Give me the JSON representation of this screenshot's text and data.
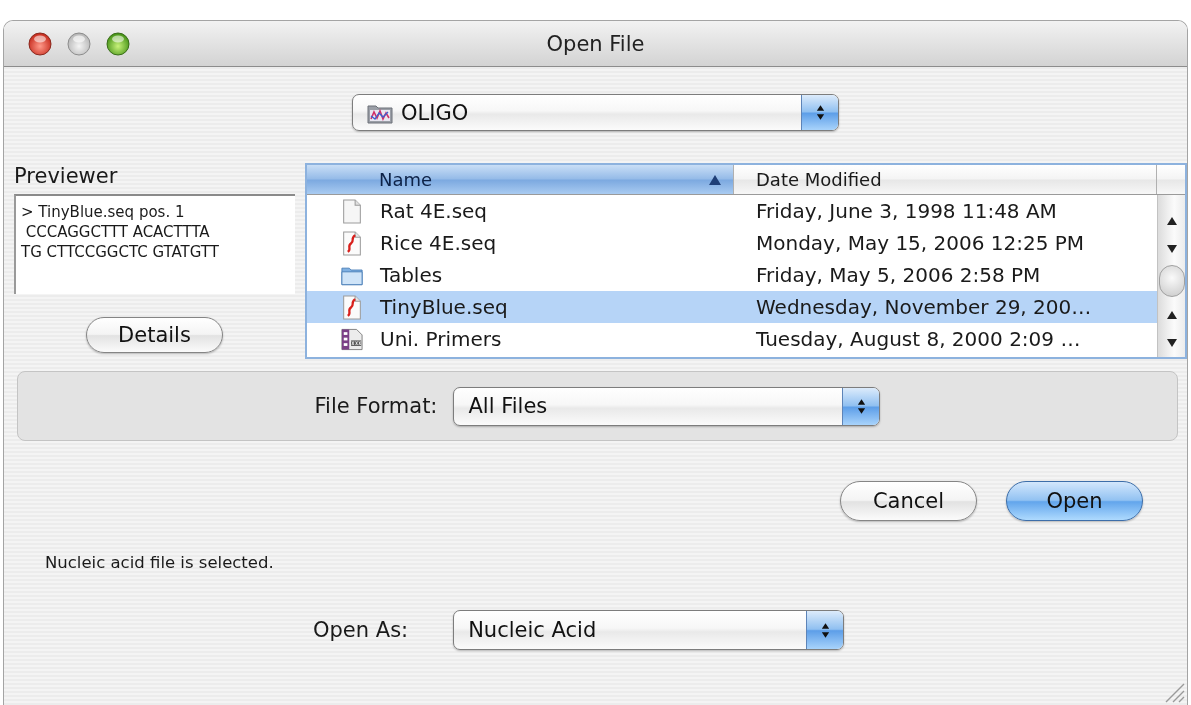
{
  "window": {
    "title": "Open File"
  },
  "location": {
    "value": "OLIGO"
  },
  "previewer": {
    "label": "Previewer",
    "lines": [
      "> TinyBlue.seq pos. 1",
      " CCCAGGCTTT ACACTTTA",
      "TG CTTCCGGCTC GTATGTT"
    ],
    "button": "Details"
  },
  "file_list": {
    "columns": [
      {
        "label": "Name",
        "sorted": true
      },
      {
        "label": "Date Modified",
        "sorted": false
      }
    ],
    "rows": [
      {
        "kind": "document",
        "name": "Rat 4E.seq",
        "date_modified": "Friday, June 3, 1998 11:48 AM",
        "selected": false
      },
      {
        "kind": "sequence",
        "name": "Rice 4E.seq",
        "date_modified": "Monday, May 15, 2006 12:25 PM",
        "selected": false
      },
      {
        "kind": "folder",
        "name": "Tables",
        "date_modified": "Friday, May 5, 2006 2:58 PM",
        "selected": false
      },
      {
        "kind": "sequence",
        "name": "TinyBlue.seq",
        "date_modified": "Wednesday, November 29, 200…",
        "selected": true
      },
      {
        "kind": "primers",
        "name": "Uni. Primers",
        "date_modified": "Tuesday, August 8, 2000 2:09 …",
        "selected": false
      }
    ]
  },
  "file_format": {
    "label": "File Format:",
    "value": "All Files"
  },
  "buttons": [
    {
      "label": "Cancel",
      "default": false
    },
    {
      "label": "Open",
      "default": true
    }
  ],
  "status": "Nucleic acid file is selected.",
  "open_as": {
    "label": "Open As:",
    "value": "Nucleic Acid"
  }
}
